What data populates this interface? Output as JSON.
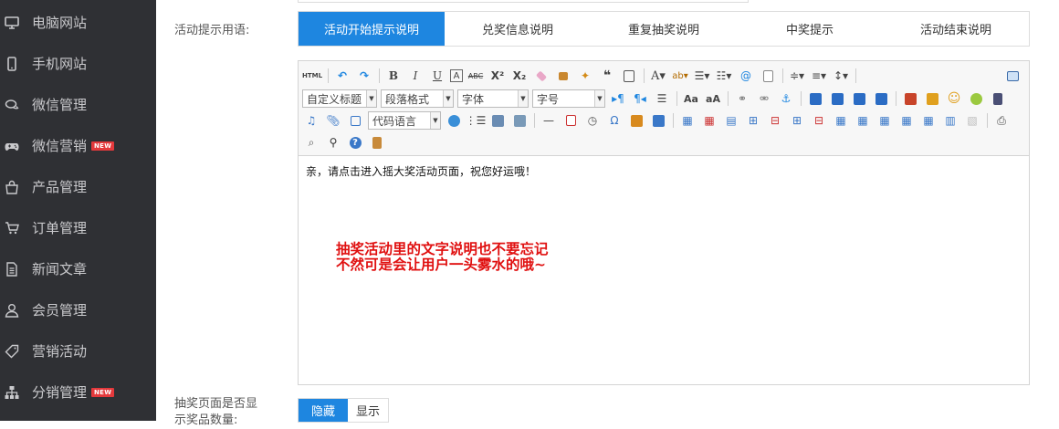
{
  "sidebar": {
    "items": [
      {
        "label": "电脑网站",
        "icon": "monitor-icon"
      },
      {
        "label": "手机网站",
        "icon": "mobile-icon"
      },
      {
        "label": "微信管理",
        "icon": "chat-icon"
      },
      {
        "label": "微信营销",
        "icon": "gamepad-icon",
        "badge": "NEW"
      },
      {
        "label": "产品管理",
        "icon": "bag-icon"
      },
      {
        "label": "订单管理",
        "icon": "cart-icon"
      },
      {
        "label": "新闻文章",
        "icon": "document-icon"
      },
      {
        "label": "会员管理",
        "icon": "user-icon"
      },
      {
        "label": "营销活动",
        "icon": "tag-icon"
      },
      {
        "label": "分销管理",
        "icon": "sitemap-icon",
        "badge": "NEW"
      }
    ]
  },
  "form": {
    "tips_label": "活动提示用语:",
    "tabs": [
      "活动开始提示说明",
      "兑奖信息说明",
      "重复抽奖说明",
      "中奖提示",
      "活动结束说明"
    ],
    "active_tab": 0,
    "editor": {
      "selects": {
        "custom_title": "自定义标题",
        "paragraph": "段落格式",
        "font": "字体",
        "size": "字号",
        "code": "代码语言"
      },
      "html_button": "HTML",
      "content": "亲，请点击进入摇大奖活动页面，祝您好运哦！"
    },
    "annotation": {
      "line1": "抽奖活动里的文字说明也不要忘记",
      "line2": "不然可是会让用户一头雾水的哦~"
    },
    "show_count_label": "抽奖页面是否显示奖品数量:",
    "toggle": {
      "hide": "隐藏",
      "show": "显示",
      "active": "hide"
    }
  },
  "colors": {
    "sidebar_bg": "#2f3034",
    "accent": "#1e86e0",
    "annotation": "#e01010",
    "badge": "#e4393c"
  }
}
